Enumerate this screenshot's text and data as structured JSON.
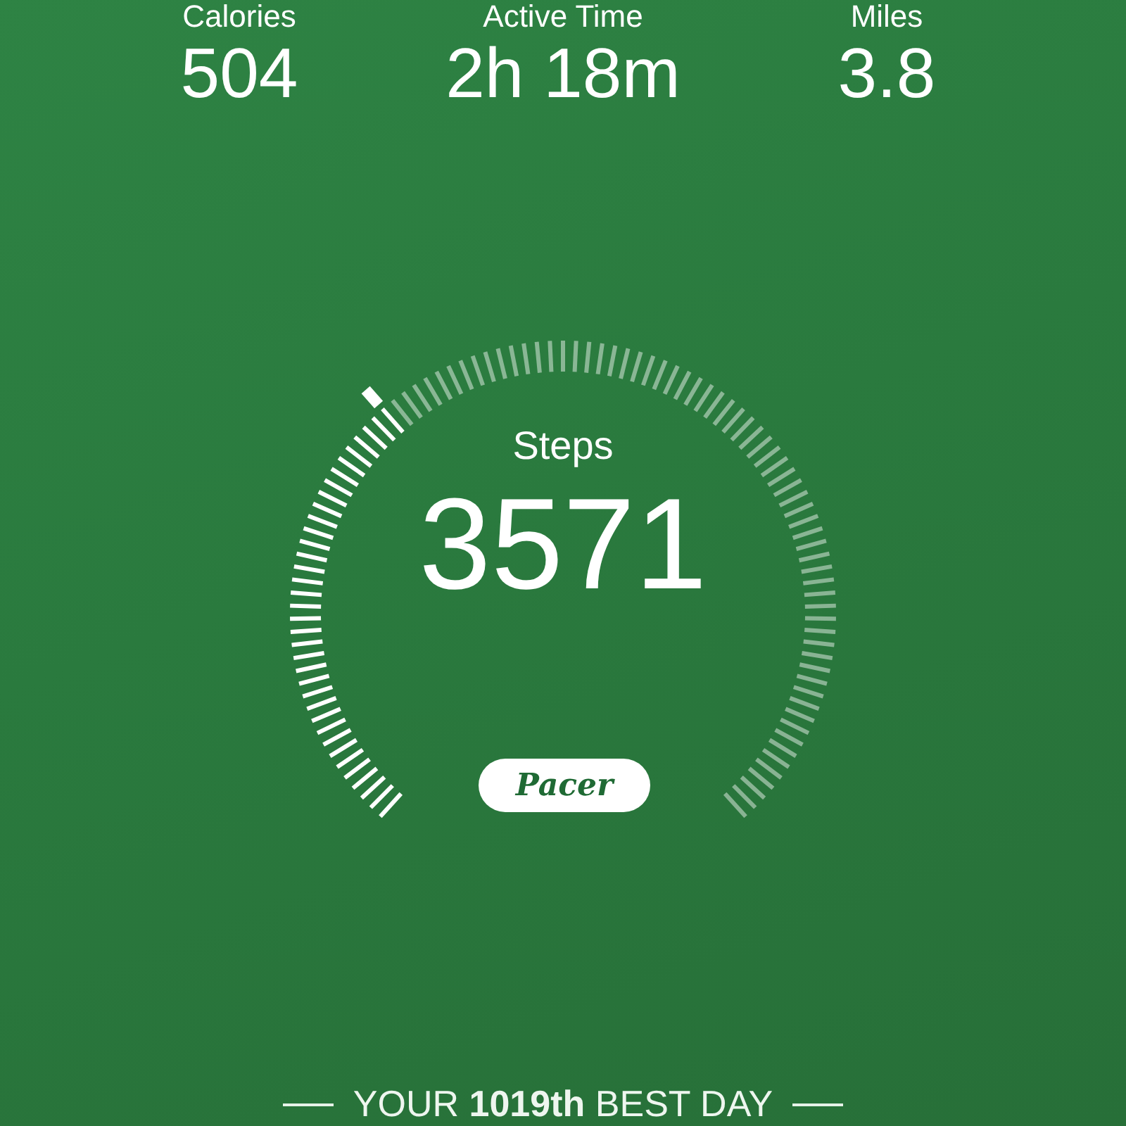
{
  "stats": [
    {
      "label": "Calories",
      "value": "504"
    },
    {
      "label": "Active Time",
      "value": "2h 18m"
    },
    {
      "label": "Miles",
      "value": "3.8"
    }
  ],
  "dial": {
    "label": "Steps",
    "value": "3571"
  },
  "brand": "Pacer",
  "footer": "YOUR **1019th** BEST DAY"
}
